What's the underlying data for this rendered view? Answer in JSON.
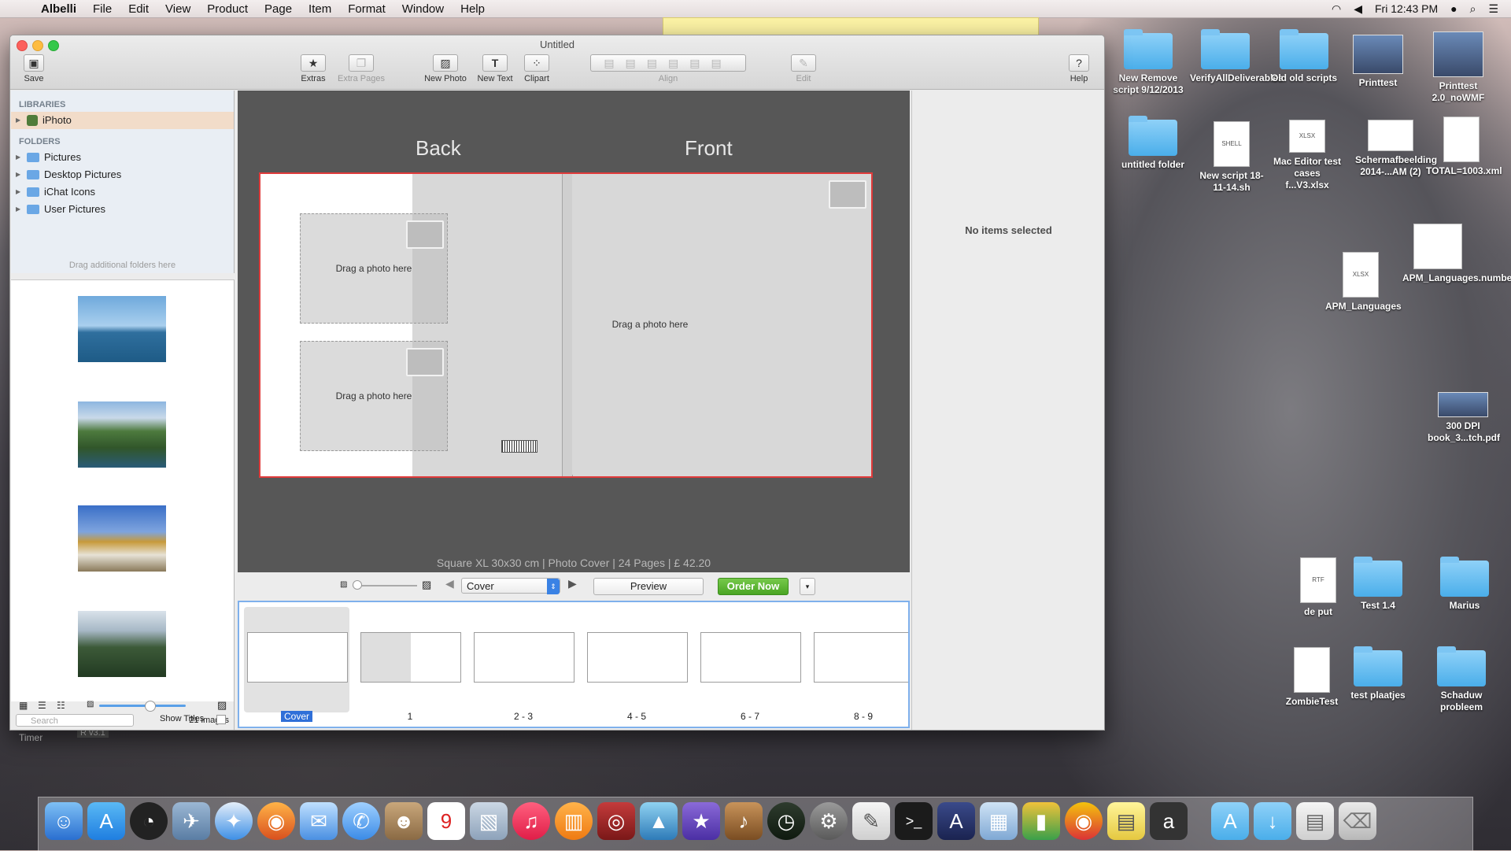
{
  "menubar": {
    "app_name": "Albelli",
    "items": [
      "File",
      "Edit",
      "View",
      "Product",
      "Page",
      "Item",
      "Format",
      "Window",
      "Help"
    ],
    "clock": "Fri 12:43 PM"
  },
  "window": {
    "title": "Untitled",
    "toolbar": {
      "save": "Save",
      "extras": "Extras",
      "extra_pages": "Extra Pages",
      "new_photo": "New Photo",
      "new_text": "New Text",
      "clipart": "Clipart",
      "align": "Align",
      "edit": "Edit",
      "help": "Help"
    }
  },
  "sidebar": {
    "libraries_header": "LIBRARIES",
    "library_items": [
      "iPhoto"
    ],
    "folders_header": "FOLDERS",
    "folder_items": [
      "Pictures",
      "Desktop Pictures",
      "iChat Icons",
      "User Pictures"
    ],
    "drag_hint": "Drag additional folders here",
    "search_placeholder": "Search",
    "image_count": "21 images",
    "show_titles": "Show Titles"
  },
  "canvas": {
    "back_label": "Back",
    "front_label": "Front",
    "placeholder_text": "Drag a photo here",
    "caption": "Square XL 30x30 cm  |  Photo Cover  |  24 Pages  |  £ 42.20"
  },
  "navbar": {
    "page_select": "Cover",
    "preview": "Preview",
    "order_now": "Order Now"
  },
  "pages": [
    {
      "label": "Cover"
    },
    {
      "label": "1"
    },
    {
      "label": "2 - 3"
    },
    {
      "label": "4 - 5"
    },
    {
      "label": "6 - 7"
    },
    {
      "label": "8 - 9"
    }
  ],
  "inspector": {
    "empty_text": "No items selected"
  },
  "desktop_icons": [
    {
      "label": "New Remove script 9/12/2013"
    },
    {
      "label": "VerifyAllDeliverables"
    },
    {
      "label": "Old old scripts"
    },
    {
      "label": "Printtest"
    },
    {
      "label": "Printtest 2.0_noWMF"
    },
    {
      "label": "untitled folder"
    },
    {
      "label": "New script 18-11-14.sh"
    },
    {
      "label": "Mac Editor test cases f...V3.xlsx"
    },
    {
      "label": "Schermafbeelding 2014-...AM (2)"
    },
    {
      "label": "TOTAL=1003.xml"
    },
    {
      "label": "APM_Languages.numbers"
    },
    {
      "label": "APM_Languages"
    },
    {
      "label": "300 DPI book_3...tch.pdf"
    },
    {
      "label": "de put"
    },
    {
      "label": "Test 1.4"
    },
    {
      "label": "Marius"
    },
    {
      "label": "ZombieTest"
    },
    {
      "label": "test plaatjes"
    },
    {
      "label": "Schaduw probleem"
    }
  ],
  "desktop_misc": {
    "timer": "Timer",
    "version": "R v3.1"
  }
}
